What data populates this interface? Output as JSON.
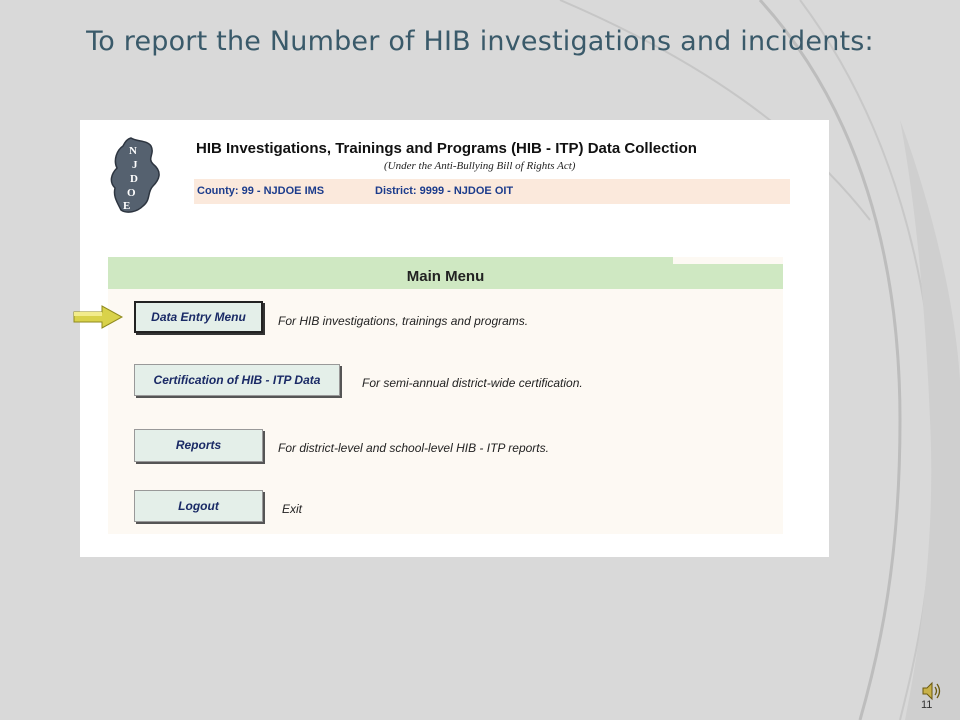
{
  "slide": {
    "title": "To report the Number of HIB investigations and incidents:",
    "page_number": "11"
  },
  "app": {
    "logo_letters": [
      "N",
      "J",
      "D",
      "O",
      "E"
    ],
    "title": "HIB Investigations, Trainings and Programs (HIB - ITP) Data Collection",
    "subtitle": "(Under the Anti-Bullying Bill of Rights Act)",
    "county": "County: 99 - NJDOE IMS",
    "district": "District: 9999 - NJDOE OIT"
  },
  "main_menu": {
    "title": "Main Menu",
    "items": [
      {
        "label": "Data Entry Menu",
        "description": "For HIB investigations, trainings and programs."
      },
      {
        "label": "Certification of HIB - ITP Data",
        "description": "For semi-annual district-wide certification."
      },
      {
        "label": "Reports",
        "description": "For district-level and school-level HIB - ITP reports."
      },
      {
        "label": "Logout",
        "description": "Exit"
      }
    ]
  },
  "icons": {
    "pointer": "arrow-right-icon",
    "audio": "speaker-icon"
  },
  "colors": {
    "slide_bg": "#d9d9d9",
    "title": "#3a5a6a",
    "header_band": "#cfe8c2",
    "info_band": "#fbe9dc",
    "info_text": "#1c3c8c",
    "button_bg": "#e4efe9",
    "button_text": "#1a2a66",
    "arrow": "#d9d24a"
  }
}
